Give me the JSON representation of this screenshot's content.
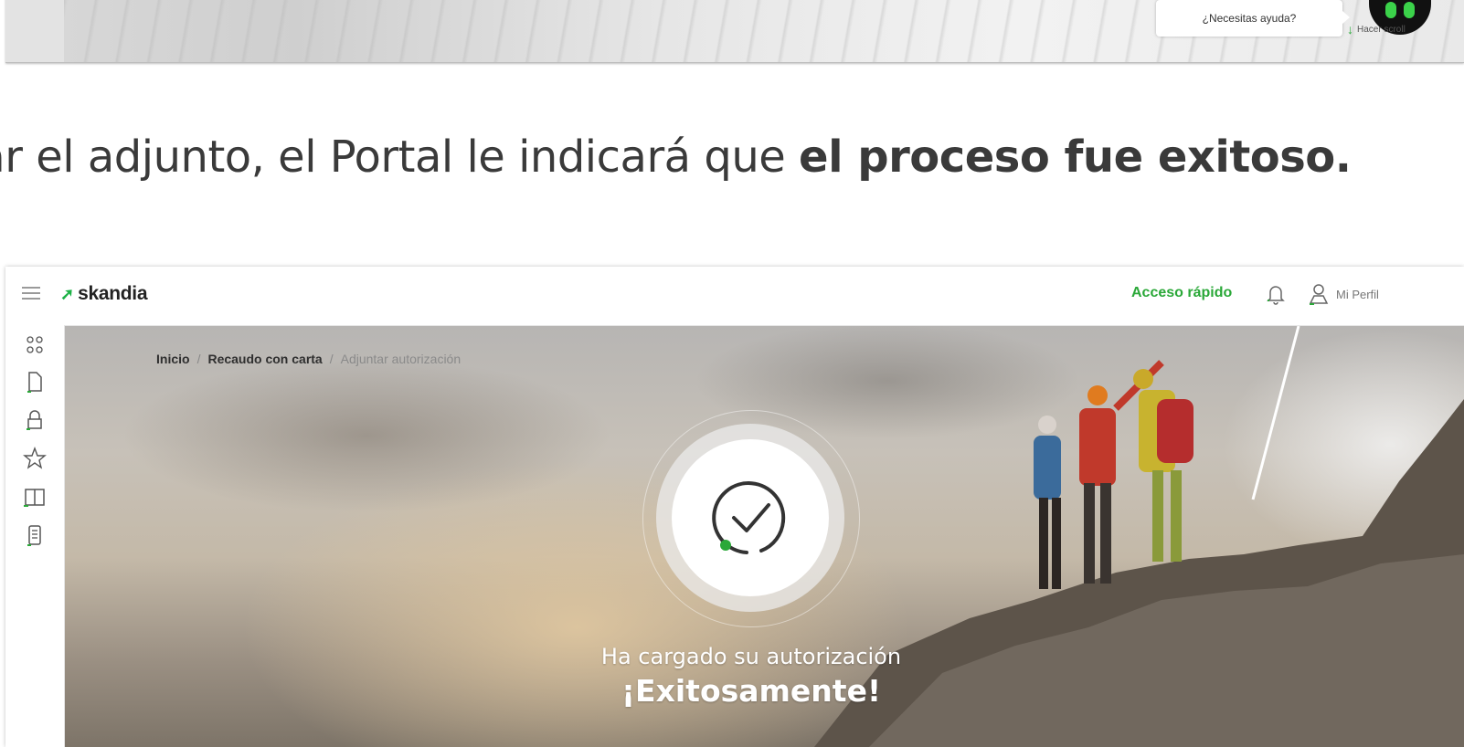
{
  "top_banner": {
    "help_text": "¿Necesitas ayuda?",
    "scroll_hint": "Hacer scroll"
  },
  "instruction": {
    "prefix": "rgar el adjunto, el Portal le indicará que ",
    "bold": "el proceso fue exitoso."
  },
  "portal": {
    "brand": "skandia",
    "header": {
      "quick_access": "Acceso rápido",
      "profile_label": "Mi Perfil"
    },
    "breadcrumb": [
      "Inicio",
      "Recaudo con carta",
      "Adjuntar autorización"
    ],
    "success": {
      "line1": "Ha cargado su autorización",
      "line2": "¡Exitosamente!"
    },
    "sidebar_icons": [
      "people-icon",
      "document-icon",
      "lock-icon",
      "star-icon",
      "book-icon",
      "list-document-icon"
    ],
    "colors": {
      "accent": "#2aa838",
      "text_dark": "#333333"
    }
  }
}
